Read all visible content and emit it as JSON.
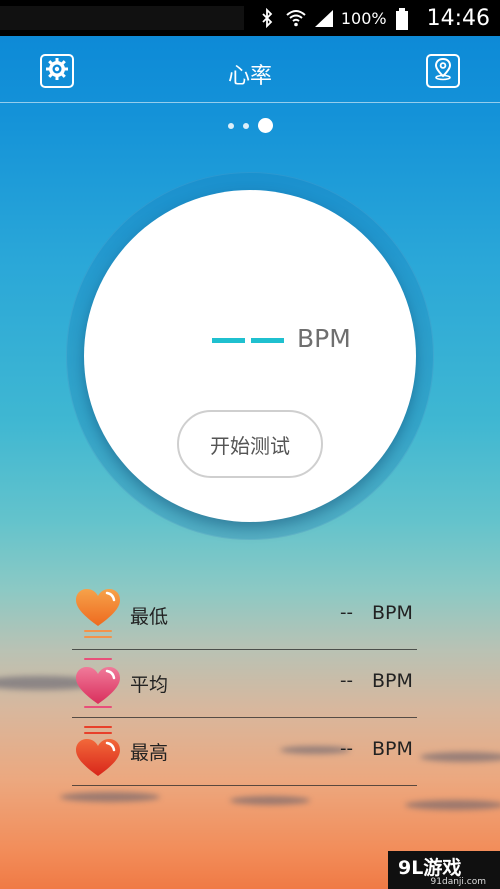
{
  "status_bar": {
    "battery_percent": "100%",
    "time": "14:46",
    "icons": [
      "bluetooth-icon",
      "wifi-icon",
      "signal-icon",
      "battery-icon"
    ]
  },
  "header": {
    "title": "心率",
    "left_icon": "settings-gear-icon",
    "right_icon": "location-pin-icon"
  },
  "pager": {
    "count": 3,
    "active_index": 2
  },
  "measurement": {
    "value_placeholder": "——",
    "unit": "BPM",
    "start_label": "开始测试"
  },
  "stats": [
    {
      "label": "最低",
      "value": "--",
      "unit": "BPM",
      "icon": "heart-low-icon",
      "color": "#f07a2a"
    },
    {
      "label": "平均",
      "value": "--",
      "unit": "BPM",
      "icon": "heart-avg-icon",
      "color": "#e5466e"
    },
    {
      "label": "最高",
      "value": "--",
      "unit": "BPM",
      "icon": "heart-high-icon",
      "color": "#e8401f"
    }
  ],
  "watermark": {
    "brand": "9L游戏",
    "site": "91danji.com"
  },
  "colors": {
    "accent": "#1fc0cf",
    "header_bg": "#0a86d6"
  }
}
